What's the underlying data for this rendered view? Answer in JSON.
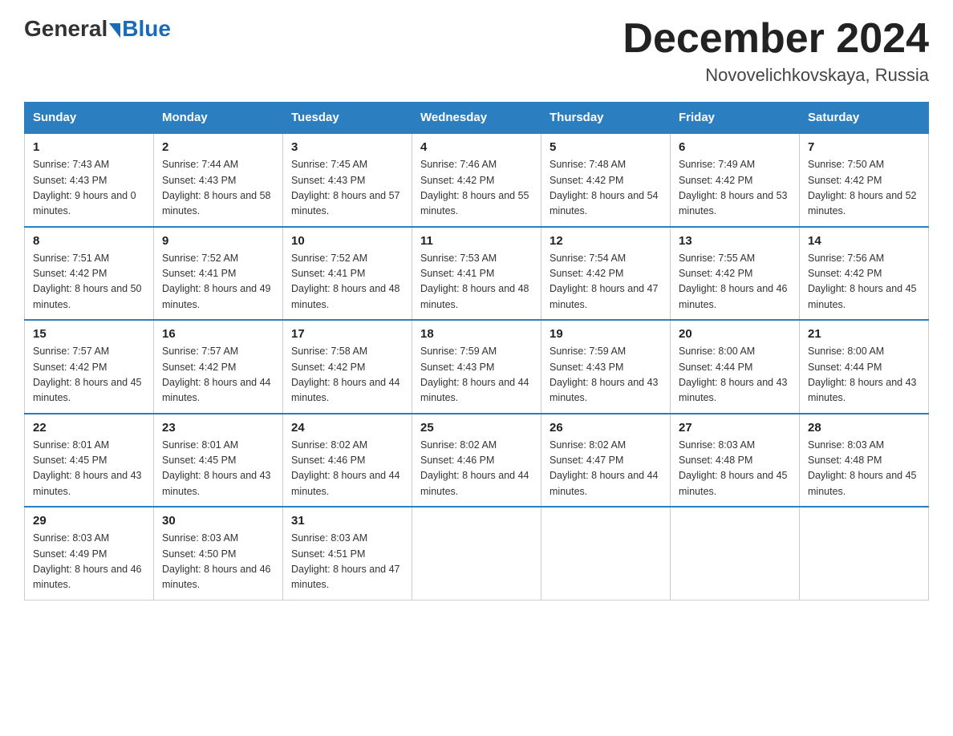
{
  "logo": {
    "general": "General",
    "blue": "Blue"
  },
  "header": {
    "month_title": "December 2024",
    "location": "Novovelichkovskaya, Russia"
  },
  "days_of_week": [
    "Sunday",
    "Monday",
    "Tuesday",
    "Wednesday",
    "Thursday",
    "Friday",
    "Saturday"
  ],
  "weeks": [
    [
      {
        "day": "1",
        "sunrise": "7:43 AM",
        "sunset": "4:43 PM",
        "daylight": "9 hours and 0 minutes."
      },
      {
        "day": "2",
        "sunrise": "7:44 AM",
        "sunset": "4:43 PM",
        "daylight": "8 hours and 58 minutes."
      },
      {
        "day": "3",
        "sunrise": "7:45 AM",
        "sunset": "4:43 PM",
        "daylight": "8 hours and 57 minutes."
      },
      {
        "day": "4",
        "sunrise": "7:46 AM",
        "sunset": "4:42 PM",
        "daylight": "8 hours and 55 minutes."
      },
      {
        "day": "5",
        "sunrise": "7:48 AM",
        "sunset": "4:42 PM",
        "daylight": "8 hours and 54 minutes."
      },
      {
        "day": "6",
        "sunrise": "7:49 AM",
        "sunset": "4:42 PM",
        "daylight": "8 hours and 53 minutes."
      },
      {
        "day": "7",
        "sunrise": "7:50 AM",
        "sunset": "4:42 PM",
        "daylight": "8 hours and 52 minutes."
      }
    ],
    [
      {
        "day": "8",
        "sunrise": "7:51 AM",
        "sunset": "4:42 PM",
        "daylight": "8 hours and 50 minutes."
      },
      {
        "day": "9",
        "sunrise": "7:52 AM",
        "sunset": "4:41 PM",
        "daylight": "8 hours and 49 minutes."
      },
      {
        "day": "10",
        "sunrise": "7:52 AM",
        "sunset": "4:41 PM",
        "daylight": "8 hours and 48 minutes."
      },
      {
        "day": "11",
        "sunrise": "7:53 AM",
        "sunset": "4:41 PM",
        "daylight": "8 hours and 48 minutes."
      },
      {
        "day": "12",
        "sunrise": "7:54 AM",
        "sunset": "4:42 PM",
        "daylight": "8 hours and 47 minutes."
      },
      {
        "day": "13",
        "sunrise": "7:55 AM",
        "sunset": "4:42 PM",
        "daylight": "8 hours and 46 minutes."
      },
      {
        "day": "14",
        "sunrise": "7:56 AM",
        "sunset": "4:42 PM",
        "daylight": "8 hours and 45 minutes."
      }
    ],
    [
      {
        "day": "15",
        "sunrise": "7:57 AM",
        "sunset": "4:42 PM",
        "daylight": "8 hours and 45 minutes."
      },
      {
        "day": "16",
        "sunrise": "7:57 AM",
        "sunset": "4:42 PM",
        "daylight": "8 hours and 44 minutes."
      },
      {
        "day": "17",
        "sunrise": "7:58 AM",
        "sunset": "4:42 PM",
        "daylight": "8 hours and 44 minutes."
      },
      {
        "day": "18",
        "sunrise": "7:59 AM",
        "sunset": "4:43 PM",
        "daylight": "8 hours and 44 minutes."
      },
      {
        "day": "19",
        "sunrise": "7:59 AM",
        "sunset": "4:43 PM",
        "daylight": "8 hours and 43 minutes."
      },
      {
        "day": "20",
        "sunrise": "8:00 AM",
        "sunset": "4:44 PM",
        "daylight": "8 hours and 43 minutes."
      },
      {
        "day": "21",
        "sunrise": "8:00 AM",
        "sunset": "4:44 PM",
        "daylight": "8 hours and 43 minutes."
      }
    ],
    [
      {
        "day": "22",
        "sunrise": "8:01 AM",
        "sunset": "4:45 PM",
        "daylight": "8 hours and 43 minutes."
      },
      {
        "day": "23",
        "sunrise": "8:01 AM",
        "sunset": "4:45 PM",
        "daylight": "8 hours and 43 minutes."
      },
      {
        "day": "24",
        "sunrise": "8:02 AM",
        "sunset": "4:46 PM",
        "daylight": "8 hours and 44 minutes."
      },
      {
        "day": "25",
        "sunrise": "8:02 AM",
        "sunset": "4:46 PM",
        "daylight": "8 hours and 44 minutes."
      },
      {
        "day": "26",
        "sunrise": "8:02 AM",
        "sunset": "4:47 PM",
        "daylight": "8 hours and 44 minutes."
      },
      {
        "day": "27",
        "sunrise": "8:03 AM",
        "sunset": "4:48 PM",
        "daylight": "8 hours and 45 minutes."
      },
      {
        "day": "28",
        "sunrise": "8:03 AM",
        "sunset": "4:48 PM",
        "daylight": "8 hours and 45 minutes."
      }
    ],
    [
      {
        "day": "29",
        "sunrise": "8:03 AM",
        "sunset": "4:49 PM",
        "daylight": "8 hours and 46 minutes."
      },
      {
        "day": "30",
        "sunrise": "8:03 AM",
        "sunset": "4:50 PM",
        "daylight": "8 hours and 46 minutes."
      },
      {
        "day": "31",
        "sunrise": "8:03 AM",
        "sunset": "4:51 PM",
        "daylight": "8 hours and 47 minutes."
      },
      null,
      null,
      null,
      null
    ]
  ]
}
